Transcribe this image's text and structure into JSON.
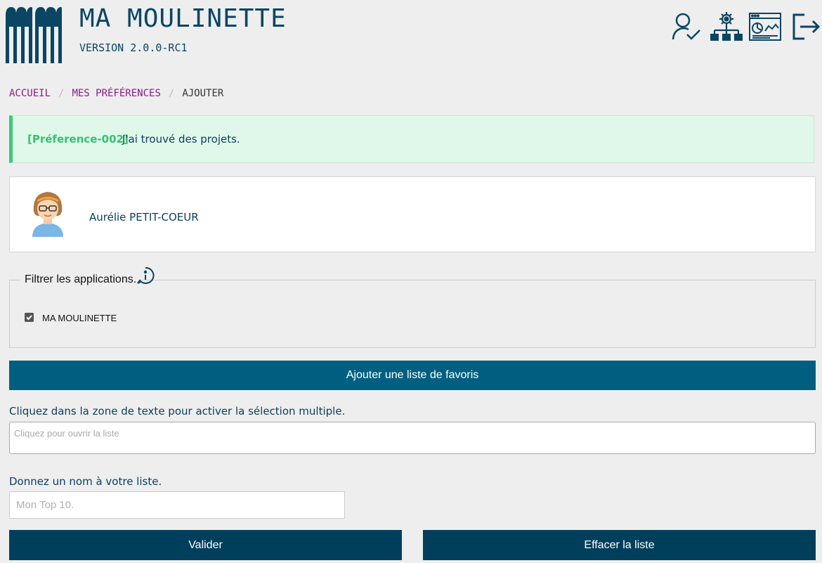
{
  "header": {
    "title": "MA MOULINETTE",
    "version": "VERSION 2.0.0-RC1",
    "icons": [
      "user-check-icon",
      "sitemap-gear-icon",
      "dashboard-browser-icon",
      "logout-icon"
    ]
  },
  "breadcrumb": {
    "home": "ACCUEIL",
    "separator": "/",
    "preferences": "MES PRÉFÉRENCES",
    "current": "AJOUTER"
  },
  "alert": {
    "code": "[Préference-002]",
    "message": "J'ai trouvé des projets.",
    "color": "#35c075"
  },
  "user": {
    "name": "Aurélie PETIT-COEUR",
    "avatar": "female-avatar-icon"
  },
  "filter": {
    "legend": "Filtrer les applications.",
    "options": [
      {
        "label": "MA MOULINETTE",
        "checked": true
      }
    ]
  },
  "actions": {
    "add_favorites": "Ajouter une liste de favoris",
    "validate": "Valider",
    "clear": "Effacer la liste"
  },
  "form": {
    "multi_label": "Cliquez dans la zone de texte pour activer la sélection multiple.",
    "multi_placeholder": "Cliquez pour ouvrir la liste",
    "name_label": "Donnez un nom à votre liste.",
    "name_placeholder": "Mon Top 10."
  },
  "colors": {
    "primary": "#005f80",
    "dark": "#003f5c",
    "link": "#8b1a8b",
    "background": "#eeeeee"
  }
}
